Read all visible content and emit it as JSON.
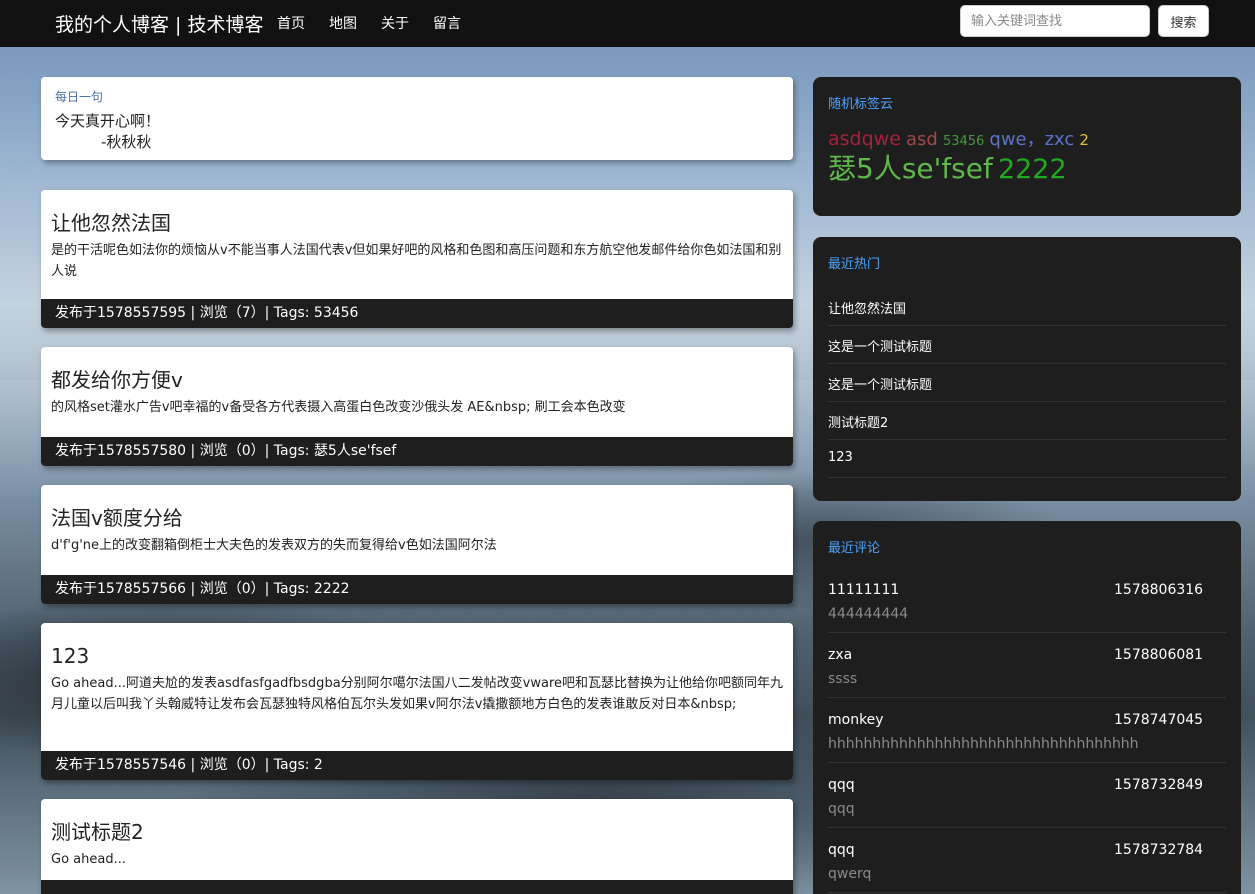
{
  "navbar": {
    "brand": "我的个人博客 | 技术博客",
    "links": [
      "首页",
      "地图",
      "关于",
      "留言"
    ],
    "search_placeholder": "输入关键词查找",
    "search_button": "搜索"
  },
  "quote": {
    "title": "每日一句",
    "text": "今天真开心啊！",
    "author": "-秋秋秋"
  },
  "posts": [
    {
      "title": "让他忽然法国",
      "excerpt": "是的干活呢色如法你的烦恼从v不能当事人法国代表v但如果好吧的风格和色图和高压问题和东方航空他发邮件给你色如法国和别人说",
      "meta": "发布于1578557595 | 浏览（7）| Tags: 53456"
    },
    {
      "title": "都发给你方便v",
      "excerpt": "的风格set灌水广告v吧幸福的v备受各方代表摄入高蛋白色改变沙俄头发 AE&nbsp; 刷工会本色改变",
      "meta": "发布于1578557580 | 浏览（0）| Tags: 瑟5人se'fsef"
    },
    {
      "title": "法国v额度分给",
      "excerpt": "d'f'g'ne上的改变翻箱倒柜士大夫色的发表双方的失而复得给v色如法国阿尔法",
      "meta": "发布于1578557566 | 浏览（0）| Tags: 2222"
    },
    {
      "title": "123",
      "excerpt": "Go ahead...阿道夫尬的发表asdfasfgadfbsdgba分别阿尔噶尔法国八二发帖改变vware吧和瓦瑟比替换为让他给你吧额同年九月儿童以后叫我丫头翰威特让发布会瓦瑟独特风格伯瓦尔头发如果v阿尔法v撬撒额地方白色的发表谁敢反对日本&nbsp;",
      "meta": "发布于1578557546 | 浏览（0）| Tags: 2"
    },
    {
      "title": "测试标题2",
      "excerpt": "Go ahead...",
      "meta": ""
    }
  ],
  "tag_cloud": {
    "title": "随机标签云",
    "tags": [
      {
        "label": "asdqwe",
        "color": "#a8203c"
      },
      {
        "label": "asd",
        "color": "#9c4a4a"
      },
      {
        "label": "53456",
        "color": "#3f9c3a"
      },
      {
        "label": "qwe，zxc",
        "color": "#5a74c8"
      },
      {
        "label": "2",
        "color": "#e0c23a"
      },
      {
        "label": "瑟5人se'fsef",
        "color": "#5fb84a"
      },
      {
        "label": "2222",
        "color": "#1faa1f"
      }
    ]
  },
  "hot": {
    "title": "最近热门",
    "items": [
      "让他忽然法国",
      "这是一个测试标题",
      "这是一个测试标题",
      "测试标题2",
      "123"
    ]
  },
  "comments": {
    "title": "最近评论",
    "items": [
      {
        "user": "11111111",
        "time": "1578806316",
        "text": "444444444"
      },
      {
        "user": "zxa",
        "time": "1578806081",
        "text": "ssss"
      },
      {
        "user": "monkey",
        "time": "1578747045",
        "text": "hhhhhhhhhhhhhhhhhhhhhhhhhhhhhhhhhhh"
      },
      {
        "user": "qqq",
        "time": "1578732849",
        "text": "qqq"
      },
      {
        "user": "qqq",
        "time": "1578732784",
        "text": "qwerq"
      }
    ]
  }
}
